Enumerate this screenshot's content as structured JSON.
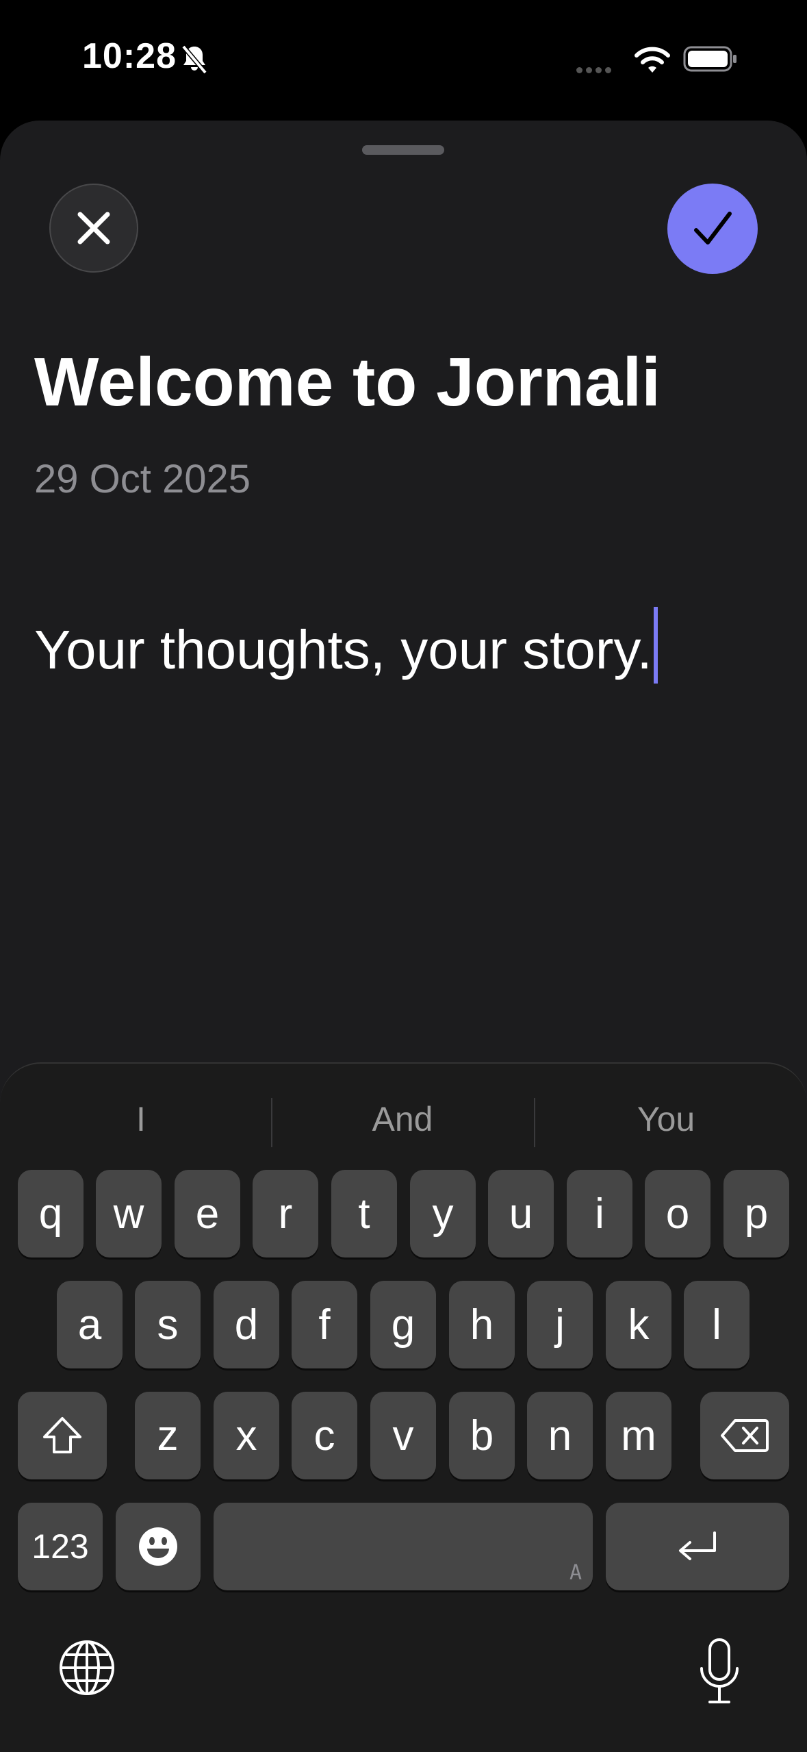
{
  "status_bar": {
    "time": "10:28"
  },
  "entry": {
    "title": "Welcome to Jornali",
    "date": "29 Oct 2025",
    "body": "Your thoughts, your story."
  },
  "colors": {
    "accent": "#7b7bf5",
    "sheet_background": "#1c1c1e",
    "key_background": "#464646"
  },
  "keyboard": {
    "suggestions": [
      "I",
      "And",
      "You"
    ],
    "row1": [
      "q",
      "w",
      "e",
      "r",
      "t",
      "y",
      "u",
      "i",
      "o",
      "p"
    ],
    "row2": [
      "a",
      "s",
      "d",
      "f",
      "g",
      "h",
      "j",
      "k",
      "l"
    ],
    "row3": [
      "z",
      "x",
      "c",
      "v",
      "b",
      "n",
      "m"
    ],
    "numbers_label": "123",
    "space_hint": "A"
  }
}
